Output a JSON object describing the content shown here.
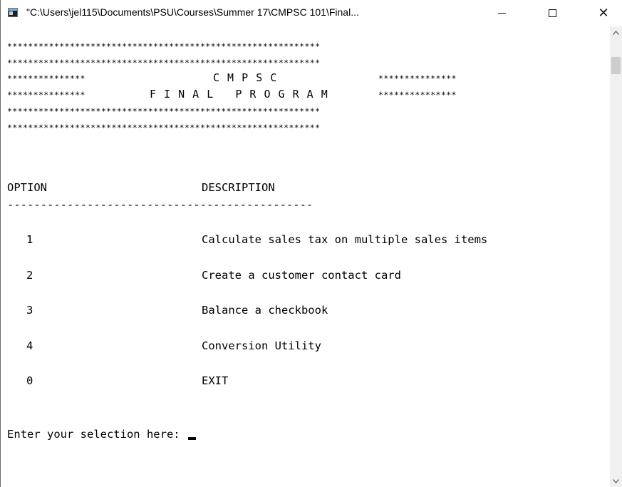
{
  "window": {
    "title": "\"C:\\Users\\jel115\\Documents\\PSU\\Courses\\Summer 17\\CMPSC 101\\Final...",
    "icons": {
      "app": "console-app-icon",
      "minimize": "minimize-icon",
      "maximize": "maximize-icon",
      "close": "close-icon"
    },
    "close_glyph": "✕"
  },
  "banner": {
    "border_line": "************************************************************",
    "title_line_left": "***************",
    "title_line_center": "C M P S C",
    "title_line_right": "***************",
    "subtitle_left": "***************",
    "subtitle_center": "F I N A L   P R O G R A M",
    "subtitle_right": "***************"
  },
  "menu": {
    "header_option": "OPTION",
    "header_description": "DESCRIPTION",
    "divider": "----------------------------------------------",
    "items": [
      {
        "option": "1",
        "description": "Calculate sales tax on multiple sales items"
      },
      {
        "option": "2",
        "description": "Create a customer contact card"
      },
      {
        "option": "3",
        "description": "Balance a checkbook"
      },
      {
        "option": "4",
        "description": "Conversion Utility"
      },
      {
        "option": "0",
        "description": "EXIT"
      }
    ]
  },
  "prompt": {
    "text": "Enter your selection here: "
  },
  "scrollbar": {
    "up": "scroll-up-arrow-icon",
    "down": "scroll-down-arrow-icon"
  }
}
